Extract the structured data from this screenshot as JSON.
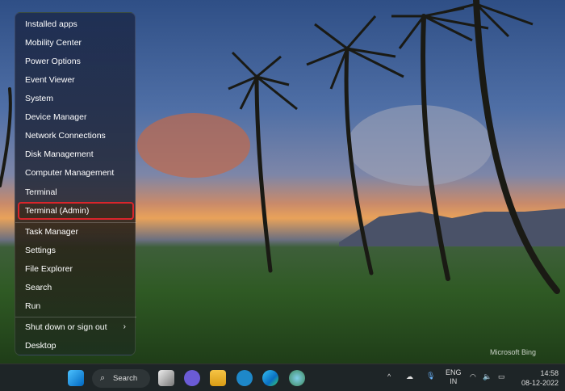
{
  "menu": {
    "items": [
      {
        "label": "Installed apps"
      },
      {
        "label": "Mobility Center"
      },
      {
        "label": "Power Options"
      },
      {
        "label": "Event Viewer"
      },
      {
        "label": "System"
      },
      {
        "label": "Device Manager"
      },
      {
        "label": "Network Connections"
      },
      {
        "label": "Disk Management"
      },
      {
        "label": "Computer Management"
      },
      {
        "label": "Terminal"
      },
      {
        "label": "Terminal (Admin)"
      },
      {
        "label": "Task Manager"
      },
      {
        "label": "Settings"
      },
      {
        "label": "File Explorer"
      },
      {
        "label": "Search"
      },
      {
        "label": "Run"
      },
      {
        "label": "Shut down or sign out"
      },
      {
        "label": "Desktop"
      }
    ],
    "selected": "Terminal (Admin)",
    "highlight_color": "#d9252b"
  },
  "watermark": "Microsoft Bing",
  "taskbar": {
    "search_label": "Search",
    "language": "ENG",
    "region": "IN",
    "time": "14:58",
    "date": "08-12-2022"
  }
}
